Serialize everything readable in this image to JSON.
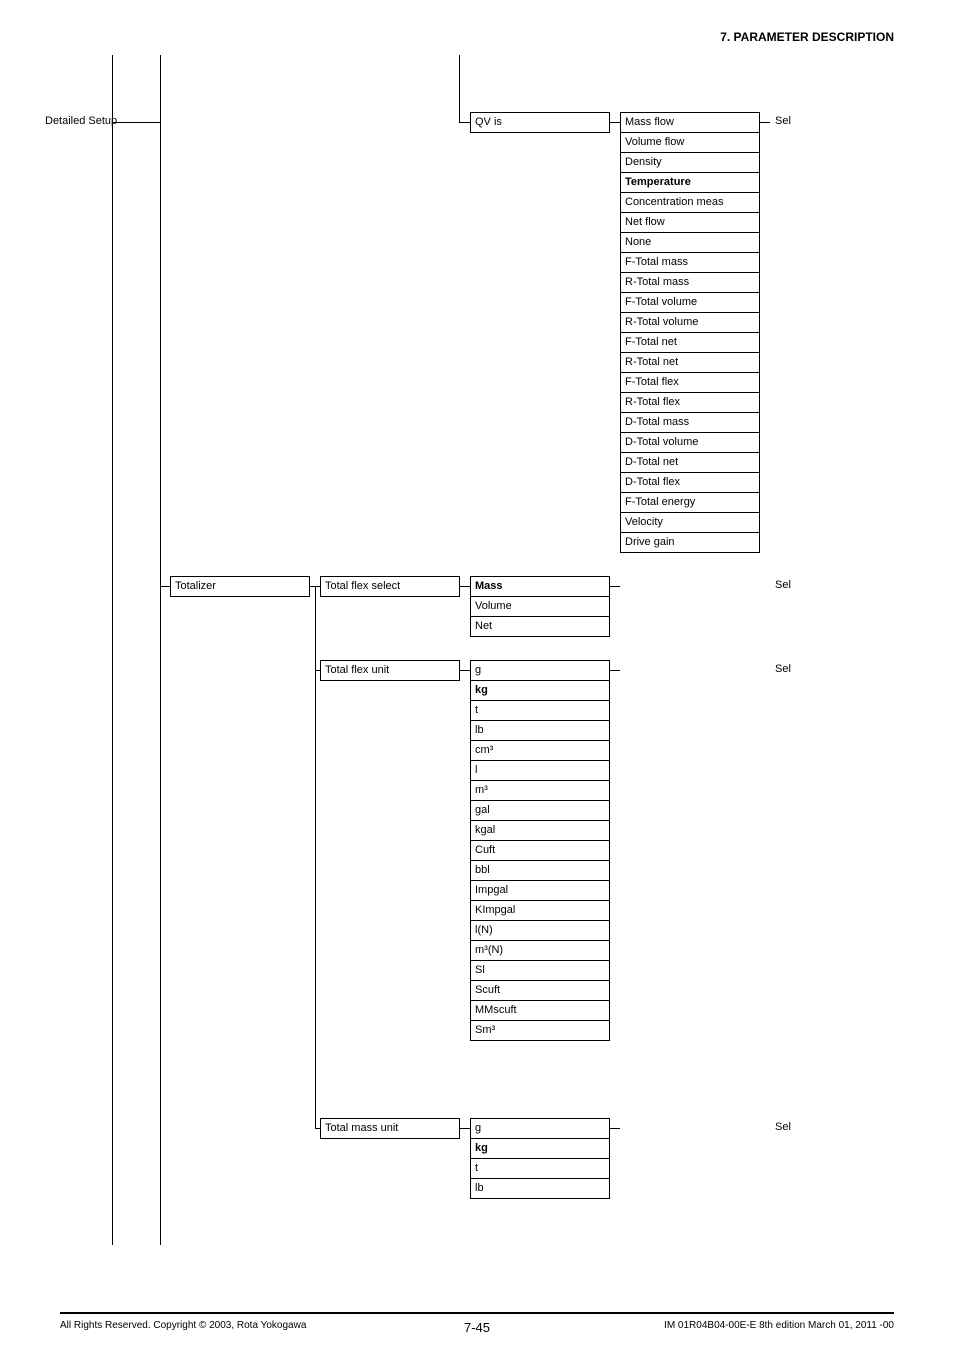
{
  "header": {
    "section": "7.  PARAMETER DESCRIPTION"
  },
  "root_label": "Detailed Setup",
  "groups": {
    "qv_is": {
      "label": "QV is",
      "sel": "Sel",
      "options": [
        {
          "text": "Mass flow"
        },
        {
          "text": "Volume flow"
        },
        {
          "text": "Density"
        },
        {
          "text": "Temperature",
          "bold": true
        },
        {
          "text": "Concentration meas"
        },
        {
          "text": "Net flow"
        },
        {
          "text": "None"
        },
        {
          "text": "F-Total mass"
        },
        {
          "text": "R-Total mass"
        },
        {
          "text": "F-Total volume"
        },
        {
          "text": "R-Total volume"
        },
        {
          "text": "F-Total net"
        },
        {
          "text": "R-Total net"
        },
        {
          "text": "F-Total flex"
        },
        {
          "text": "R-Total flex"
        },
        {
          "text": "D-Total mass"
        },
        {
          "text": "D-Total volume"
        },
        {
          "text": "D-Total net"
        },
        {
          "text": "D-Total flex"
        },
        {
          "text": "F-Total energy"
        },
        {
          "text": "Velocity"
        },
        {
          "text": "Drive gain"
        }
      ]
    },
    "totalizer": {
      "label": "Totalizer",
      "flex_select": {
        "label": "Total flex select",
        "sel": "Sel",
        "options": [
          {
            "text": "Mass",
            "bold": true
          },
          {
            "text": "Volume"
          },
          {
            "text": "Net"
          }
        ]
      },
      "flex_unit": {
        "label": "Total flex unit",
        "sel": "Sel",
        "options": [
          {
            "text": "g"
          },
          {
            "text": "kg",
            "bold": true
          },
          {
            "text": "t"
          },
          {
            "text": "lb"
          },
          {
            "text": "cm³"
          },
          {
            "text": "l"
          },
          {
            "text": "m³"
          },
          {
            "text": "gal"
          },
          {
            "text": "kgal"
          },
          {
            "text": "Cuft"
          },
          {
            "text": "bbl"
          },
          {
            "text": "Impgal"
          },
          {
            "text": "KImpgal"
          },
          {
            "text": "l(N)"
          },
          {
            "text": "m³(N)"
          },
          {
            "text": "Sl"
          },
          {
            "text": "Scuft"
          },
          {
            "text": "MMscuft"
          },
          {
            "text": "Sm³"
          }
        ]
      },
      "mass_unit": {
        "label": "Total mass unit",
        "sel": "Sel",
        "options": [
          {
            "text": "g"
          },
          {
            "text": "kg",
            "bold": true
          },
          {
            "text": "t"
          },
          {
            "text": "lb"
          }
        ]
      }
    }
  },
  "footer": {
    "copyright": "All Rights Reserved. Copyright © 2003, Rota Yokogawa",
    "page_num": "7-45",
    "doc_id": "IM 01R04B04-00E-E  8th edition March 01, 2011 -00"
  }
}
